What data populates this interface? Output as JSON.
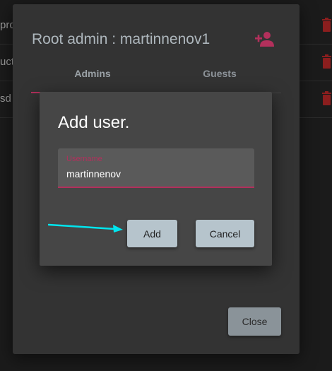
{
  "background_list": {
    "rows": [
      {
        "text": "pro",
        "icon": "trash-icon"
      },
      {
        "text": "uct",
        "icon": "trash-icon"
      },
      {
        "text": "sd",
        "icon": "trash-icon"
      }
    ]
  },
  "outer_dialog": {
    "title": "Root admin : martinnenov1",
    "add_icon": "add-person-icon",
    "tabs": [
      {
        "label": "Admins",
        "selected": true
      },
      {
        "label": "Guests",
        "selected": false
      }
    ],
    "close_label": "Close"
  },
  "inner_dialog": {
    "title": "Add user.",
    "username_field": {
      "label": "Username",
      "value": "martinnenov"
    },
    "add_label": "Add",
    "cancel_label": "Cancel"
  },
  "annotation": {
    "icon": "arrow-icon",
    "color": "#00e5ee"
  },
  "colors": {
    "accent": "#b3305c",
    "trash": "#8b1e1e",
    "button": "#b6c4cc"
  }
}
